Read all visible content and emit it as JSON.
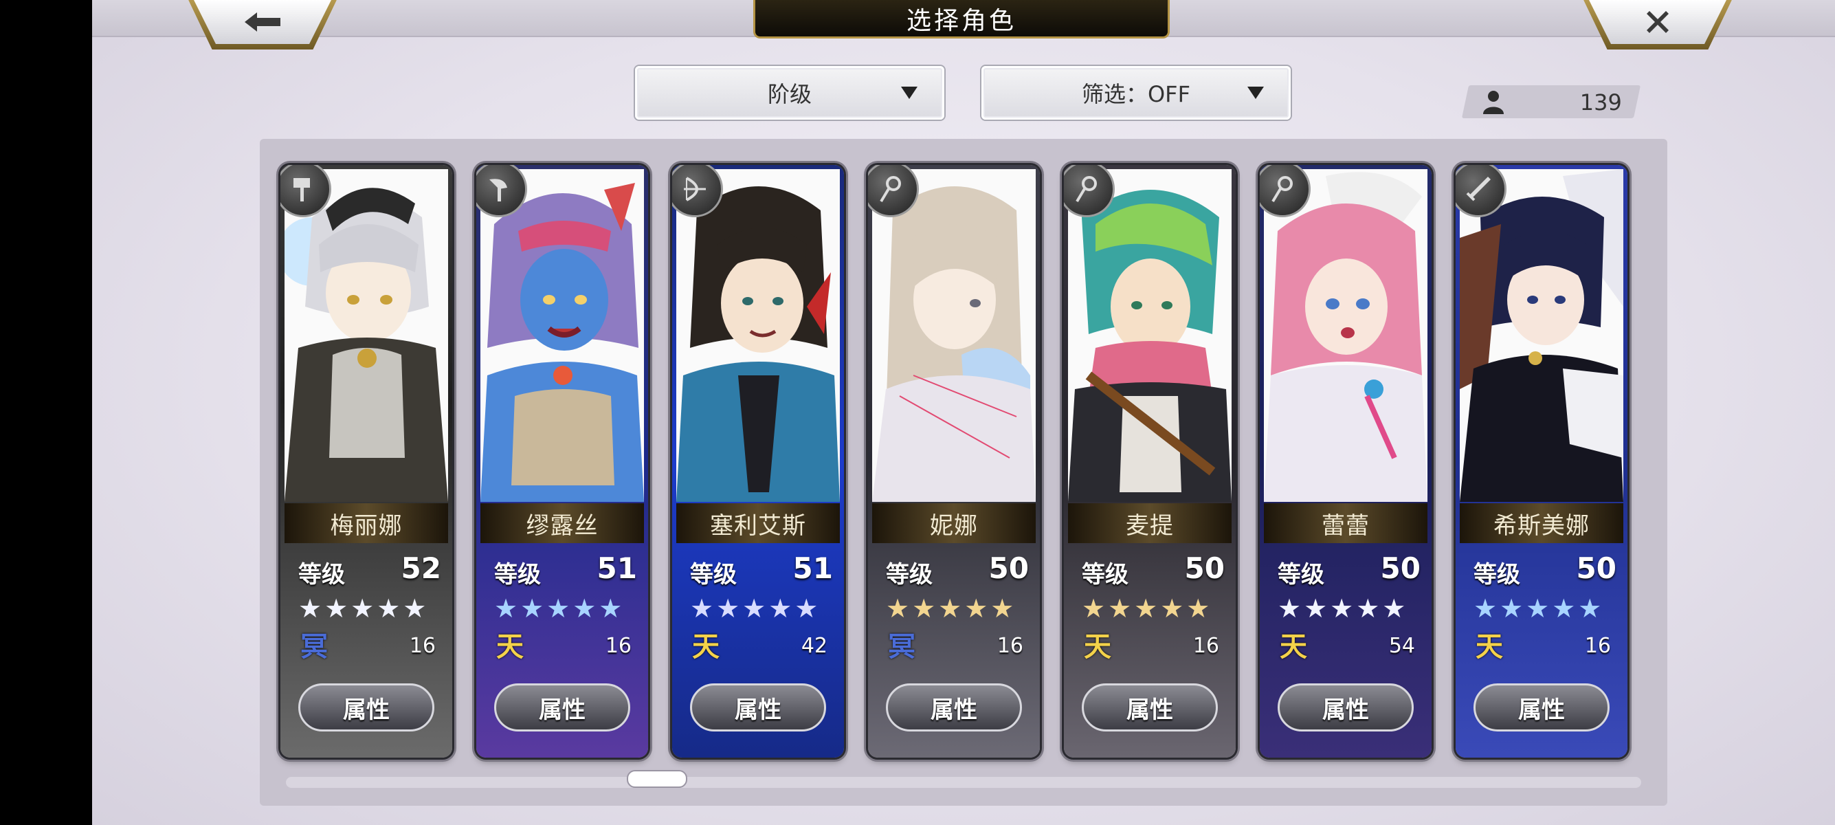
{
  "header": {
    "title": "选择角色",
    "back_icon": "arrow-left-icon",
    "close_icon": "close-icon"
  },
  "controls": {
    "rank_select": "阶级",
    "filter_select": "筛选：OFF",
    "roster_count": "139"
  },
  "colors": {
    "gold_star": "#f2d590",
    "blue_star": "#a8d4ff",
    "white_star": "#f2f4ff",
    "heaven_class": "#f4d24a",
    "underworld_class": "#4a6cd8"
  },
  "characters": [
    {
      "name": "梅丽娜",
      "level_label": "等级",
      "level": "52",
      "stars": "★★★★★",
      "class_glyph": "冥",
      "count": "16",
      "button": "属性",
      "weapon_icon": "hammer-icon"
    },
    {
      "name": "缪露丝",
      "level_label": "等级",
      "level": "51",
      "stars": "★★★★★",
      "class_glyph": "天",
      "count": "16",
      "button": "属性",
      "weapon_icon": "axe-icon"
    },
    {
      "name": "塞利艾斯",
      "level_label": "等级",
      "level": "51",
      "stars": "★★★★★",
      "class_glyph": "天",
      "count": "42",
      "button": "属性",
      "weapon_icon": "bow-icon"
    },
    {
      "name": "妮娜",
      "level_label": "等级",
      "level": "50",
      "stars": "★★★★★",
      "class_glyph": "冥",
      "count": "16",
      "button": "属性",
      "weapon_icon": "staff-icon"
    },
    {
      "name": "麦提",
      "level_label": "等级",
      "level": "50",
      "stars": "★★★★★",
      "class_glyph": "天",
      "count": "16",
      "button": "属性",
      "weapon_icon": "staff-icon"
    },
    {
      "name": "蕾蕾",
      "level_label": "等级",
      "level": "50",
      "stars": "★★★★★",
      "class_glyph": "天",
      "count": "54",
      "button": "属性",
      "weapon_icon": "staff-icon"
    },
    {
      "name": "希斯美娜",
      "level_label": "等级",
      "level": "50",
      "stars": "★★★★★",
      "class_glyph": "天",
      "count": "16",
      "button": "属性",
      "weapon_icon": "sword-icon"
    }
  ]
}
